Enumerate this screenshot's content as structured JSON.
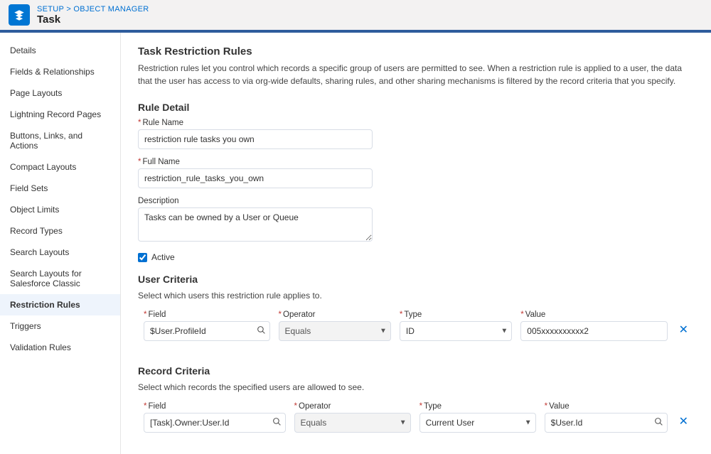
{
  "breadcrumb": "SETUP > OBJECT MANAGER",
  "page_title": "Task",
  "sidebar": {
    "items": [
      {
        "label": "Details",
        "active": false
      },
      {
        "label": "Fields & Relationships",
        "active": false
      },
      {
        "label": "Page Layouts",
        "active": false
      },
      {
        "label": "Lightning Record Pages",
        "active": false
      },
      {
        "label": "Buttons, Links, and Actions",
        "active": false
      },
      {
        "label": "Compact Layouts",
        "active": false
      },
      {
        "label": "Field Sets",
        "active": false
      },
      {
        "label": "Object Limits",
        "active": false
      },
      {
        "label": "Record Types",
        "active": false
      },
      {
        "label": "Search Layouts",
        "active": false
      },
      {
        "label": "Search Layouts for Salesforce Classic",
        "active": false
      },
      {
        "label": "Restriction Rules",
        "active": true
      },
      {
        "label": "Triggers",
        "active": false
      },
      {
        "label": "Validation Rules",
        "active": false
      }
    ]
  },
  "main": {
    "title": "Task Restriction Rules",
    "intro": "Restriction rules let you control which records a specific group of users are permitted to see. When a restriction rule is applied to a user, the data that the user has access to via org-wide defaults, sharing rules, and other sharing mechanisms is filtered by the record criteria that you specify.",
    "rule_detail": {
      "heading": "Rule Detail",
      "rule_name_label": "Rule Name",
      "rule_name_value": "restriction rule tasks you own",
      "full_name_label": "Full Name",
      "full_name_value": "restriction_rule_tasks_you_own",
      "description_label": "Description",
      "description_value": "Tasks can be owned by a User or Queue",
      "active_label": "Active",
      "active_checked": true
    },
    "user_criteria": {
      "heading": "User Criteria",
      "desc": "Select which users this restriction rule applies to.",
      "field_label": "Field",
      "field_value": "$User.ProfileId",
      "operator_label": "Operator",
      "operator_value": "Equals",
      "type_label": "Type",
      "type_value": "ID",
      "value_label": "Value",
      "value_value": "005xxxxxxxxxx2"
    },
    "record_criteria": {
      "heading": "Record Criteria",
      "desc": "Select which records the specified users are allowed to see.",
      "field_label": "Field",
      "field_value": "[Task].Owner:User.Id",
      "operator_label": "Operator",
      "operator_value": "Equals",
      "type_label": "Type",
      "type_value": "Current User",
      "value_label": "Value",
      "value_value": "$User.Id"
    }
  }
}
